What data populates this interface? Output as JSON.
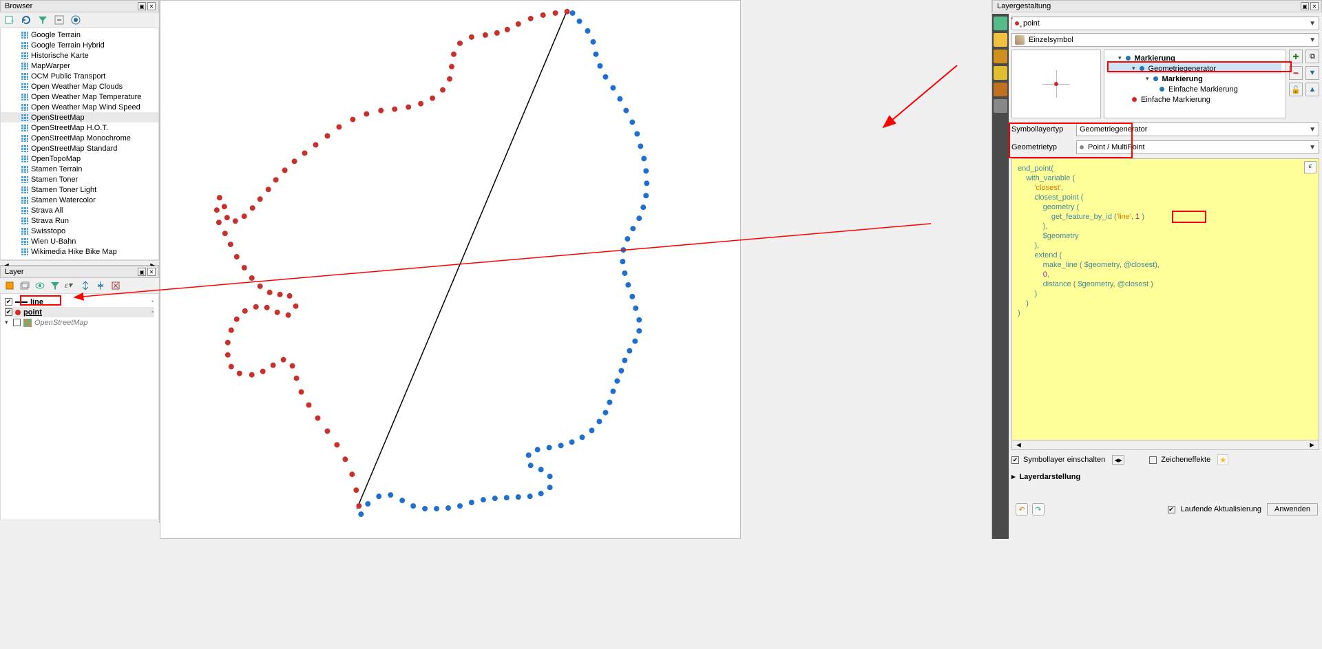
{
  "browser": {
    "title": "Browser",
    "items": [
      "Google Terrain",
      "Google Terrain Hybrid",
      "Historische Karte",
      "MapWarper",
      "OCM Public Transport",
      "Open Weather Map Clouds",
      "Open Weather Map Temperature",
      "Open Weather Map Wind Speed",
      "OpenStreetMap",
      "OpenStreetMap H.O.T.",
      "OpenStreetMap Monochrome",
      "OpenStreetMap Standard",
      "OpenTopoMap",
      "Stamen Terrain",
      "Stamen Toner",
      "Stamen Toner Light",
      "Stamen Watercolor",
      "Strava All",
      "Strava Run",
      "Swisstopo",
      "Wien U-Bahn",
      "Wikimedia Hike Bike Map"
    ],
    "selected": "OpenStreetMap"
  },
  "layers": {
    "title": "Layer",
    "items": [
      {
        "name": "line",
        "checked": true,
        "type": "line",
        "bold": true
      },
      {
        "name": "point",
        "checked": true,
        "type": "point",
        "bold": true
      },
      {
        "name": "OpenStreetMap",
        "checked": false,
        "type": "raster",
        "italic": true
      }
    ]
  },
  "styling": {
    "title": "Layergestaltung",
    "layer": "point",
    "renderer": "Einzelsymbol",
    "tree": {
      "root": "Markierung",
      "gen": "Geometriegenerator",
      "mark2": "Markierung",
      "simple": "Einfache Markierung",
      "simple2": "Einfache Markierung"
    },
    "symlayer_label": "Symbollayertyp",
    "symlayer_value": "Geometriegenerator",
    "geomtype_label": "Geometrietyp",
    "geomtype_value": "Point / MultiPoint",
    "expression": "end_point(\n    with_variable (\n        'closest',\n        closest_point (\n            geometry (\n                get_feature_by_id ('line', 1 )\n            ),\n            $geometry\n        ),\n        extend (\n            make_line ( $geometry, @closest),\n            0,\n            distance ( $geometry, @closest )\n        )\n    )\n)",
    "enable_sym": "Symbollayer einschalten",
    "draw_effects": "Zeicheneffekte",
    "section": "Layerdarstellung",
    "live_update": "Laufende Aktualisierung",
    "apply": "Anwenden"
  }
}
